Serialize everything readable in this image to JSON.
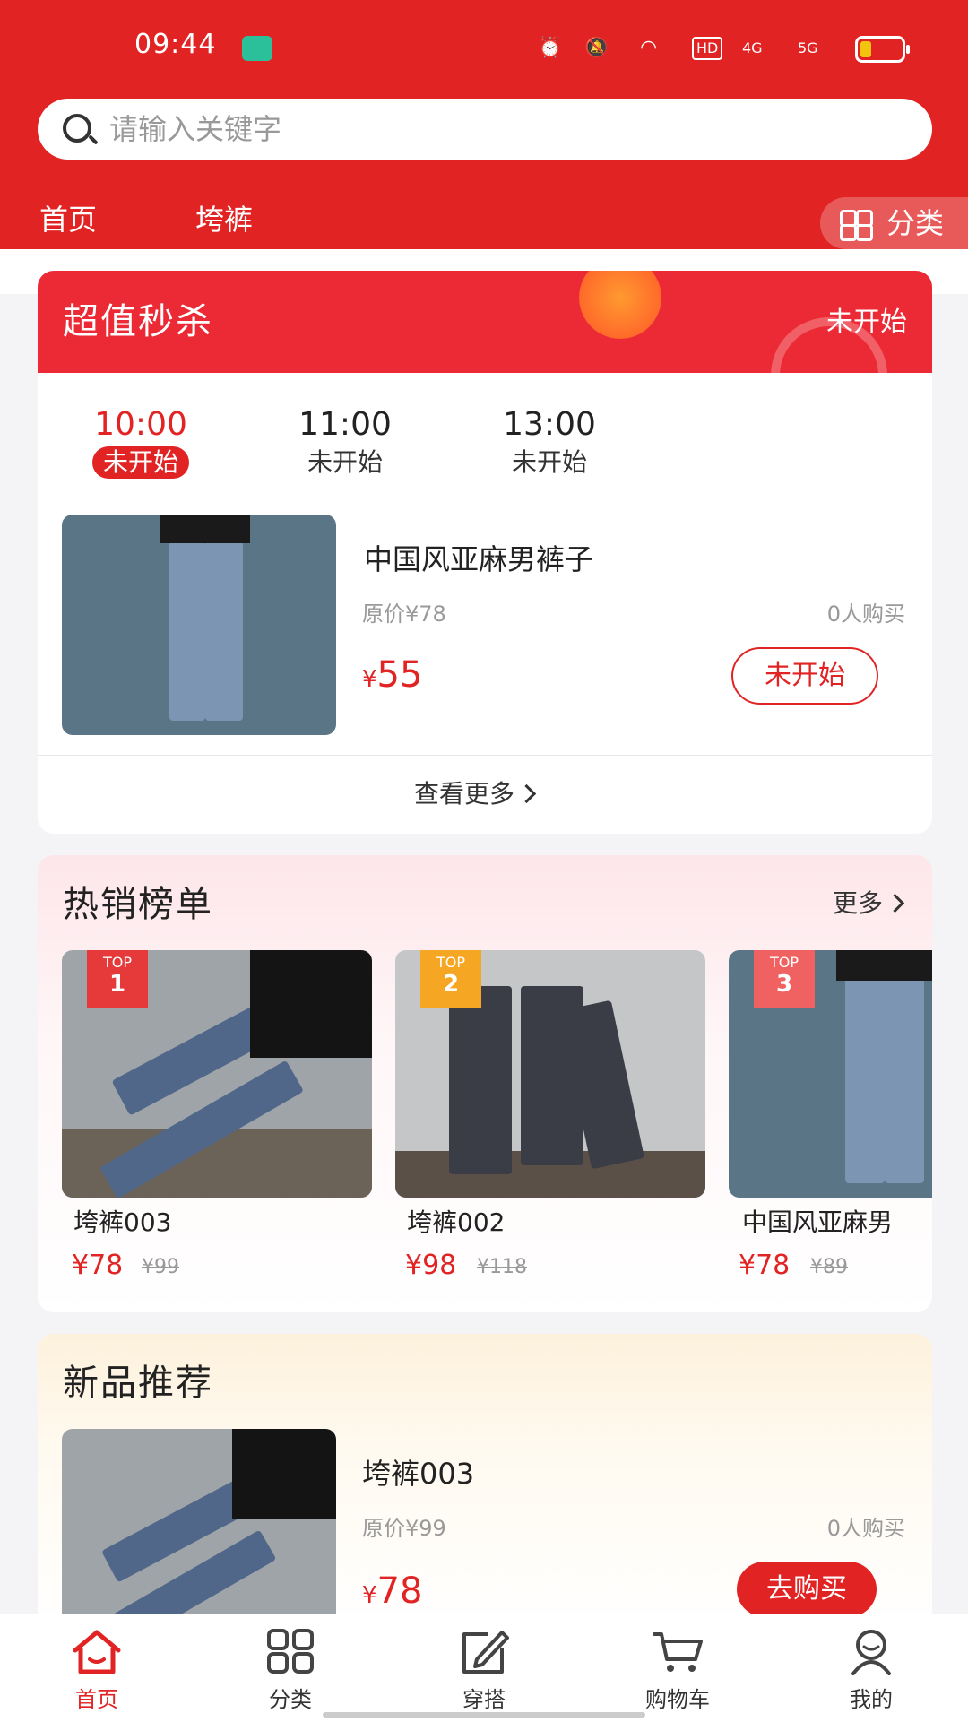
{
  "status_bar": {
    "time": "09:44",
    "network_4g": "4G",
    "network_5g": "5G",
    "hd": "HD"
  },
  "search": {
    "placeholder": "请输入关键字"
  },
  "nav": {
    "tabs": [
      "首页",
      "垮裤"
    ],
    "category_label": "分类"
  },
  "seckill": {
    "title": "超值秒杀",
    "status": "未开始",
    "slots": [
      {
        "time": "10:00",
        "status": "未开始",
        "active": true
      },
      {
        "time": "11:00",
        "status": "未开始"
      },
      {
        "time": "13:00",
        "status": "未开始"
      }
    ],
    "product": {
      "name": "中国风亚麻男裤子",
      "original_price": "原价¥78",
      "sold": "0人购买",
      "currency": "¥",
      "price": "55",
      "button": "未开始"
    },
    "more": "查看更多"
  },
  "hot": {
    "title": "热销榜单",
    "more": "更多",
    "badge_text": "TOP",
    "items": [
      {
        "rank": "1",
        "name": "垮裤003",
        "price": "¥78",
        "old": "¥99",
        "badge_color": "#e63a3a"
      },
      {
        "rank": "2",
        "name": "垮裤002",
        "price": "¥98",
        "old": "¥118",
        "badge_color": "#f5a623"
      },
      {
        "rank": "3",
        "name": "中国风亚麻男",
        "price": "¥78",
        "old": "¥89",
        "badge_color": "#f06262"
      }
    ]
  },
  "new_products": {
    "title": "新品推荐",
    "product": {
      "name": "垮裤003",
      "original_price": "原价¥99",
      "sold": "0人购买",
      "currency": "¥",
      "price": "78",
      "button": "去购买"
    }
  },
  "tabbar": {
    "items": [
      {
        "label": "首页",
        "icon": "home-icon",
        "active": true
      },
      {
        "label": "分类",
        "icon": "grid-icon"
      },
      {
        "label": "穿搭",
        "icon": "edit-icon"
      },
      {
        "label": "购物车",
        "icon": "cart-icon"
      },
      {
        "label": "我的",
        "icon": "user-icon"
      }
    ]
  },
  "colors": {
    "brand": "#e12323",
    "seckill_header": "#ec2a35"
  }
}
